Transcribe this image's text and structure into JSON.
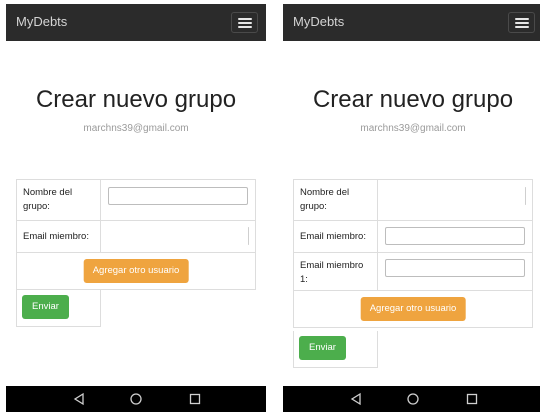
{
  "left": {
    "navbar": {
      "brand": "MyDebts",
      "menu_icon": "hamburger-menu-icon"
    },
    "title": "Crear nuevo grupo",
    "email": "marchns39@gmail.com",
    "form": {
      "group_name_label": "Nombre del grupo:",
      "group_name_value": "",
      "member_label": "Email miembro:",
      "member_value": "",
      "add_label": "Agregar otro usuario",
      "send_label": "Enviar"
    },
    "sysbar": {
      "back_icon": "back-triangle-icon",
      "home_icon": "home-circle-icon",
      "recent_icon": "recent-apps-square-icon"
    }
  },
  "right": {
    "navbar": {
      "brand": "MyDebts",
      "menu_icon": "hamburger-menu-icon"
    },
    "title": "Crear nuevo grupo",
    "email": "marchns39@gmail.com",
    "form": {
      "group_name_label": "Nombre del grupo:",
      "group_name_value": "",
      "member_label": "Email miembro:",
      "member_value": "",
      "member1_label": "Email miembro 1:",
      "member1_value": "",
      "add_label": "Agregar otro usuario",
      "send_label": "Enviar"
    },
    "sysbar": {
      "back_icon": "back-triangle-icon",
      "home_icon": "home-circle-icon",
      "recent_icon": "recent-apps-square-icon"
    }
  },
  "colors": {
    "navbar_bg": "#2b2b2b",
    "add_button": "#efa43f",
    "send_button": "#4cae4c",
    "system_bar": "#000000"
  }
}
